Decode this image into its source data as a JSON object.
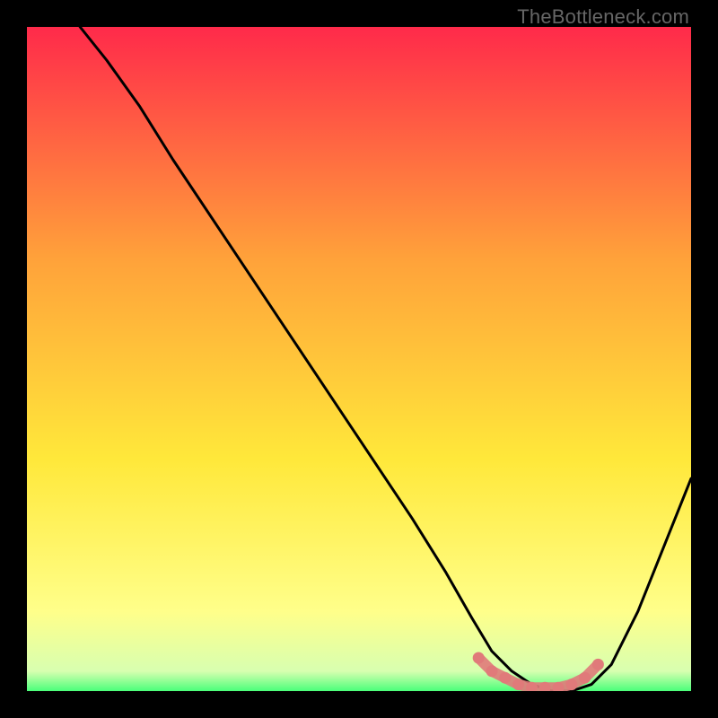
{
  "watermark": "TheBottleneck.com",
  "chart_data": {
    "type": "line",
    "title": "",
    "xlabel": "",
    "ylabel": "",
    "xlim": [
      0,
      100
    ],
    "ylim": [
      0,
      100
    ],
    "background_gradient": {
      "top": "#ff2a4a",
      "mid_upper": "#ffa23a",
      "mid": "#ffe83a",
      "mid_lower": "#ffff8a",
      "bottom": "#4aff7a"
    },
    "series": [
      {
        "name": "bottleneck-curve",
        "stroke": "#000000",
        "x": [
          8,
          12,
          17,
          22,
          30,
          40,
          50,
          58,
          63,
          67,
          70,
          73,
          76,
          79,
          82,
          85,
          88,
          92,
          96,
          100
        ],
        "y": [
          100,
          95,
          88,
          80,
          68,
          53,
          38,
          26,
          18,
          11,
          6,
          3,
          1,
          0,
          0,
          1,
          4,
          12,
          22,
          32
        ]
      },
      {
        "name": "optimal-band",
        "stroke": "#e07a7a",
        "x": [
          68,
          70,
          72,
          74,
          76,
          78,
          80,
          82,
          84,
          86
        ],
        "y": [
          5,
          3,
          2,
          1,
          0.5,
          0.5,
          0.5,
          1,
          2,
          4
        ]
      }
    ]
  }
}
